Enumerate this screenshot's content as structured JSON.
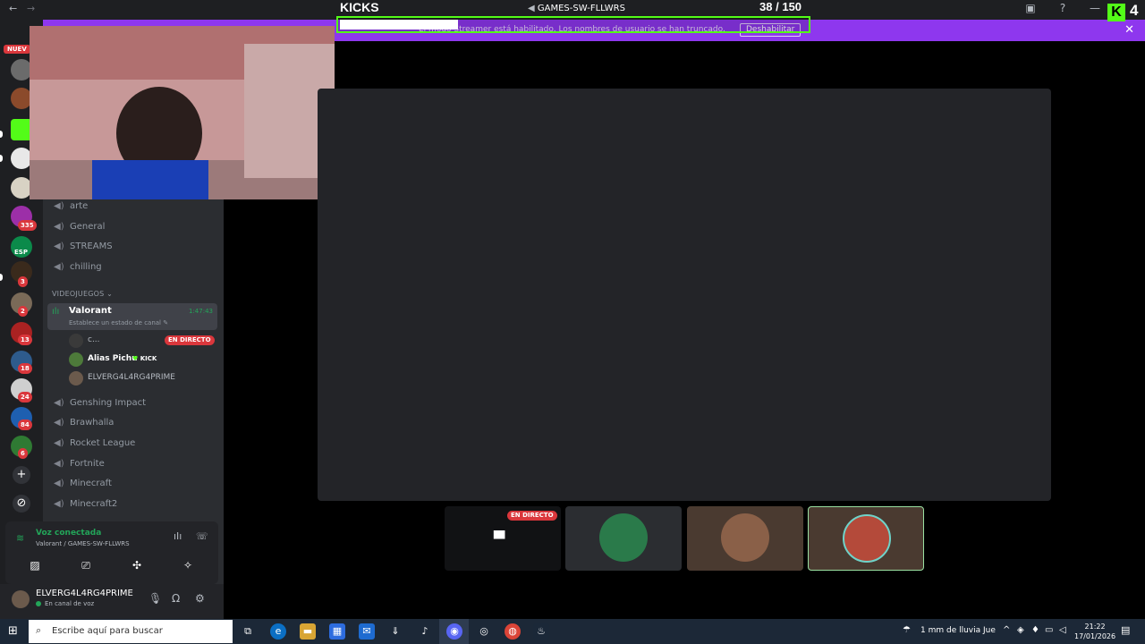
{
  "window": {
    "back": "←",
    "forward": "→",
    "inbox_icon": "inbox-icon",
    "help_icon": "?",
    "minimize": "—",
    "maximize": "☐",
    "close": "✕"
  },
  "banner": {
    "text": "El modo Streamer está habilitado. Los nombres de usuario se han truncado.",
    "button": "Deshabilitar",
    "close": "✕",
    "color": "#8e37ee"
  },
  "kicks": {
    "label": "KICKS",
    "channel": "GAMES-SW-FLLWRS",
    "count": "38",
    "separator": "/",
    "goal": "150",
    "progress_fraction": 0.253,
    "logo": "K",
    "counter": "4",
    "accent": "#53fc18"
  },
  "rail": {
    "nuevo": "NUEV",
    "badges": [
      "335",
      "3",
      "2",
      "13",
      "18",
      "24",
      "84",
      "6"
    ],
    "esp": "ESP",
    "add_icon": "+",
    "discover_icon": "compass-icon"
  },
  "channels": {
    "voice_channels_top": [
      "arte",
      "General",
      "STREAMS",
      "chilling"
    ],
    "category": "VIDEOJUEGOS",
    "active": {
      "name": "Valorant",
      "status": "Establece un estado de canal",
      "timer": "1:47:43"
    },
    "users": [
      {
        "name": "c...",
        "badge": "EN DIRECTO"
      },
      {
        "name": "Alias Pichu",
        "badge": "KICK"
      },
      {
        "name": "ELVERG4L4RG4PRIME",
        "badge": ""
      }
    ],
    "voice_channels_bottom": [
      "Genshing Impact",
      "Brawhalla",
      "Rocket League",
      "Fortnite",
      "Minecraft",
      "Minecraft2"
    ]
  },
  "voice_panel": {
    "title": "Voz conectada",
    "path": "Valorant / GAMES-SW-FLLWRS"
  },
  "user": {
    "name": "ELVERG4L4RG4PRIME",
    "status": "En canal de voz"
  },
  "stage": {
    "live_badge": "EN DIRECTO"
  },
  "taskbar": {
    "search_placeholder": "Escribe aquí para buscar",
    "weather": "1 mm de lluvia Jue",
    "time": "21:22",
    "date": "17/01/2026"
  }
}
